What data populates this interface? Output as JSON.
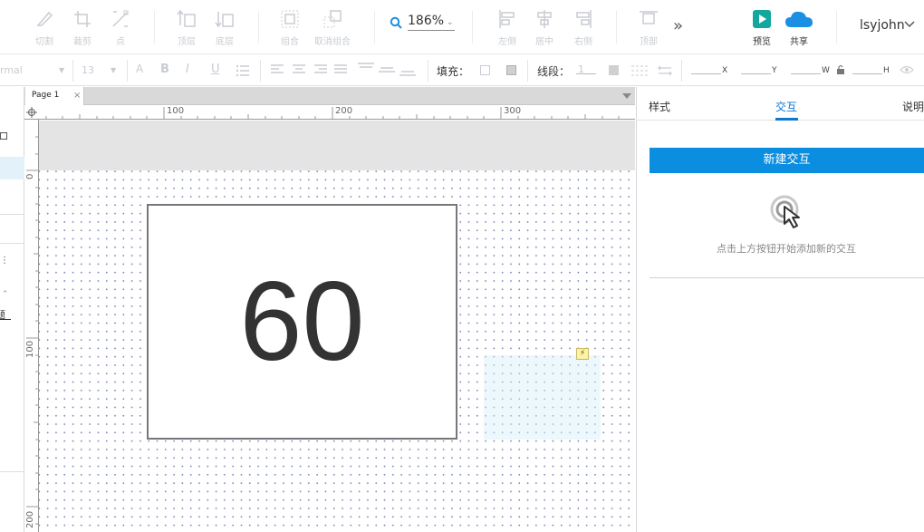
{
  "toolbar": {
    "items": [
      {
        "label": "切割",
        "icon": "knife-icon"
      },
      {
        "label": "裁剪",
        "icon": "crop-icon"
      },
      {
        "label": "点",
        "icon": "point-icon"
      },
      {
        "label": "顶层",
        "icon": "bring-to-front-icon"
      },
      {
        "label": "底层",
        "icon": "send-to-back-icon"
      },
      {
        "label": "组合",
        "icon": "group-icon"
      },
      {
        "label": "取消组合",
        "icon": "ungroup-icon"
      },
      {
        "label": "左侧",
        "icon": "align-left-icon"
      },
      {
        "label": "居中",
        "icon": "align-center-icon"
      },
      {
        "label": "右侧",
        "icon": "align-right-icon"
      },
      {
        "label": "顶部",
        "icon": "align-top-icon"
      },
      {
        "label": "预览",
        "icon": "preview-icon"
      },
      {
        "label": "共享",
        "icon": "share-cloud-icon"
      }
    ],
    "zoom": "186%",
    "username": "lsyjohn",
    "colors": {
      "preview": "#13a89e",
      "share": "#1a8fe3",
      "zoom_icon": "#1a8fe3"
    }
  },
  "format": {
    "font_style": "rmal",
    "font_size": "13",
    "fill_label": "填充：",
    "stroke_label": "线段：",
    "stroke_value": "1",
    "x_label": "X",
    "y_label": "Y",
    "w_label": "W",
    "h_label": "H"
  },
  "tabs": [
    {
      "label": "Page 1",
      "close": "×"
    }
  ],
  "rulers": {
    "h": [
      "100",
      "200",
      "300"
    ],
    "v": [
      "0",
      "100",
      "200"
    ]
  },
  "canvas": {
    "widget_text": "60"
  },
  "left_strip_fragments": [
    "题"
  ],
  "right_panel": {
    "tabs": [
      {
        "label": "样式",
        "active": false
      },
      {
        "label": "交互",
        "active": true
      },
      {
        "label": "说明",
        "active": false
      }
    ],
    "new_interaction_button": "新建交互",
    "empty_hint": "点击上方按钮开始添加新的交互",
    "accent": "#0b78d4"
  }
}
